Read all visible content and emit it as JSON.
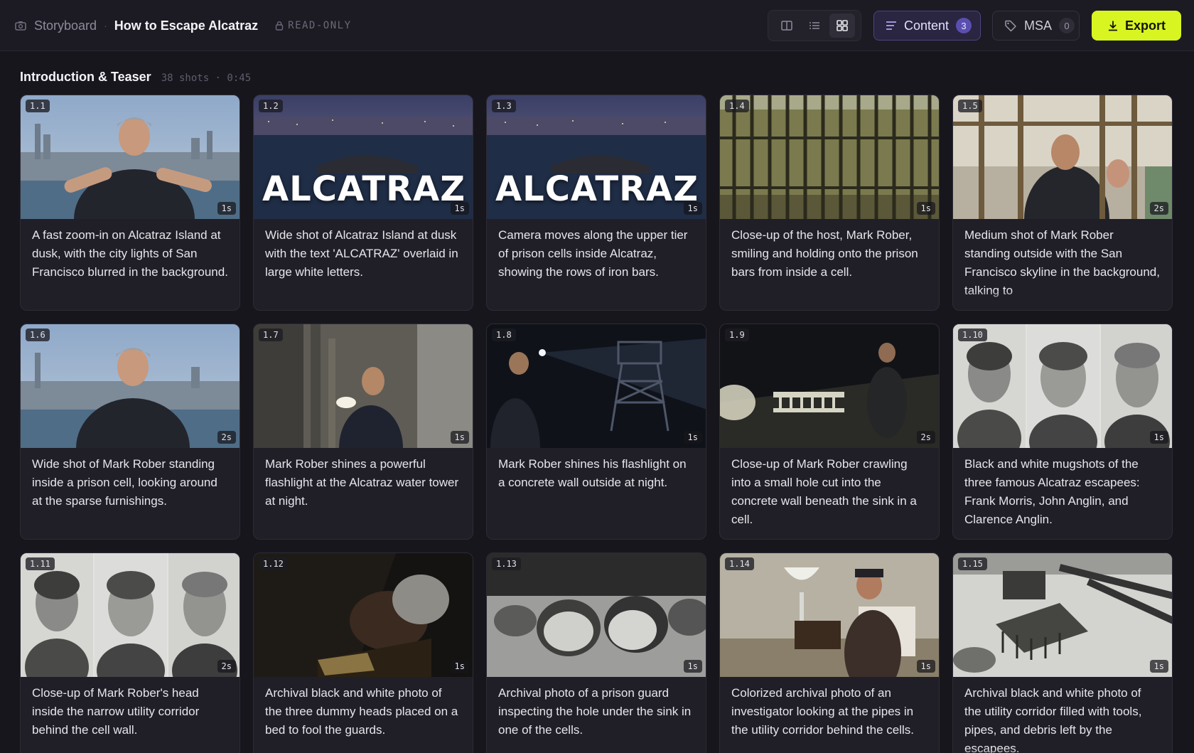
{
  "topbar": {
    "breadcrumb_root": "Storyboard",
    "breadcrumb_sep": "·",
    "project_title": "How to Escape Alcatraz",
    "readonly_label": "READ-ONLY",
    "content_label": "Content",
    "content_count": "3",
    "msa_label": "MSA",
    "msa_count": "0",
    "export_label": "Export",
    "accent_color": "#d8f521"
  },
  "section": {
    "title": "Introduction & Teaser",
    "meta": "38 shots · 0:45"
  },
  "shots": [
    {
      "num": "1.1",
      "dur": "1s",
      "desc": "A fast zoom-in on Alcatraz Island at dusk, with the city lights of San Francisco blurred in the background."
    },
    {
      "num": "1.2",
      "dur": "1s",
      "overlay": "ALCATRAZ",
      "desc": "Wide shot of Alcatraz Island at dusk with the text 'ALCATRAZ' overlaid in large white letters."
    },
    {
      "num": "1.3",
      "dur": "1s",
      "overlay": "ALCATRAZ",
      "desc": "Camera moves along the upper tier of prison cells inside Alcatraz, showing the rows of iron bars."
    },
    {
      "num": "1.4",
      "dur": "1s",
      "desc": "Close-up of the host, Mark Rober, smiling and holding onto the prison bars from inside a cell."
    },
    {
      "num": "1.5",
      "dur": "2s",
      "desc": "Medium shot of Mark Rober standing outside with the San Francisco skyline in the background, talking to"
    },
    {
      "num": "1.6",
      "dur": "2s",
      "desc": "Wide shot of Mark Rober standing inside a prison cell, looking around at the sparse furnishings."
    },
    {
      "num": "1.7",
      "dur": "1s",
      "desc": "Mark Rober shines a powerful flashlight at the Alcatraz water tower at night."
    },
    {
      "num": "1.8",
      "dur": "1s",
      "desc": "Mark Rober shines his flashlight on a concrete wall outside at night."
    },
    {
      "num": "1.9",
      "dur": "2s",
      "desc": "Close-up of Mark Rober crawling into a small hole cut into the concrete wall beneath the sink in a cell."
    },
    {
      "num": "1.10",
      "dur": "1s",
      "desc": "Black and white mugshots of the three famous Alcatraz escapees: Frank Morris, John Anglin, and Clarence Anglin."
    },
    {
      "num": "1.11",
      "dur": "2s",
      "desc": "Close-up of Mark Rober's head inside the narrow utility corridor behind the cell wall."
    },
    {
      "num": "1.12",
      "dur": "1s",
      "desc": "Archival black and white photo of the three dummy heads placed on a bed to fool the guards."
    },
    {
      "num": "1.13",
      "dur": "1s",
      "desc": "Archival photo of a prison guard inspecting the hole under the sink in one of the cells."
    },
    {
      "num": "1.14",
      "dur": "1s",
      "desc": "Colorized archival photo of an investigator looking at the pipes in the utility corridor behind the cells."
    },
    {
      "num": "1.15",
      "dur": "1s",
      "desc": "Archival black and white photo of the utility corridor filled with tools, pipes, and debris left by the escapees."
    }
  ]
}
